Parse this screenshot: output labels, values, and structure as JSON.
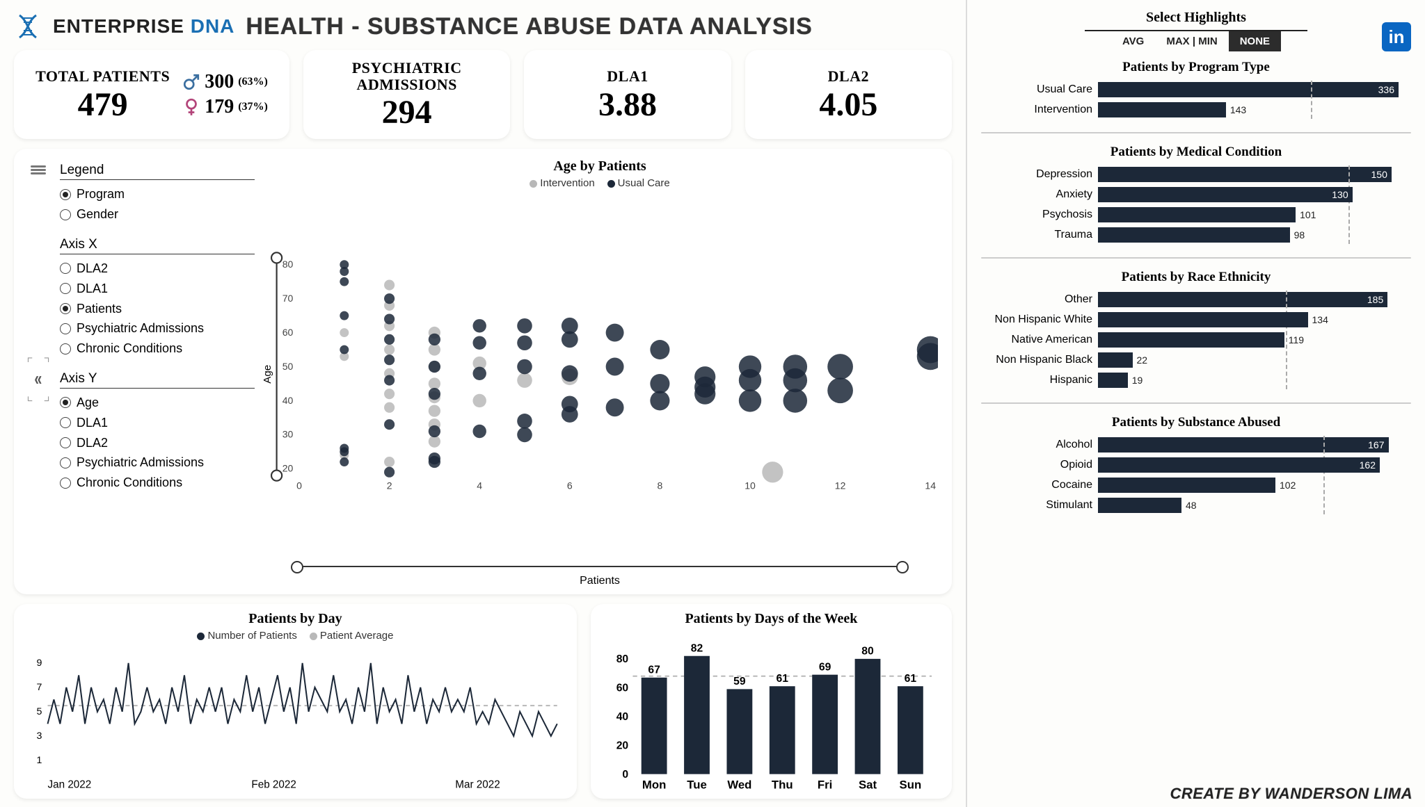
{
  "header": {
    "brand_pre": "ENTERPRISE",
    "brand_post": "DNA",
    "title": "HEALTH - SUBSTANCE ABUSE DATA ANALYSIS"
  },
  "kpis": {
    "total": {
      "label": "TOTAL PATIENTS",
      "value": "479",
      "male": {
        "count": "300",
        "pct": "(63%)"
      },
      "female": {
        "count": "179",
        "pct": "(37%)"
      }
    },
    "psych": {
      "label": "PSYCHIATRIC ADMISSIONS",
      "value": "294"
    },
    "dla1": {
      "label": "DLA1",
      "value": "3.88"
    },
    "dla2": {
      "label": "DLA2",
      "value": "4.05"
    }
  },
  "scatter": {
    "title": "Age by Patients",
    "legend": {
      "intervention": "Intervention",
      "usual": "Usual Care"
    },
    "controls": {
      "legend": {
        "title": "Legend",
        "items": [
          "Program",
          "Gender"
        ],
        "selected": "Program"
      },
      "axisX": {
        "title": "Axis X",
        "items": [
          "DLA2",
          "DLA1",
          "Patients",
          "Psychiatric Admissions",
          "Chronic Conditions"
        ],
        "selected": "Patients"
      },
      "axisY": {
        "title": "Axis Y",
        "items": [
          "Age",
          "DLA1",
          "DLA2",
          "Psychiatric Admissions",
          "Chronic Conditions"
        ],
        "selected": "Age"
      }
    },
    "xlabel": "Patients",
    "ylabel": "Age"
  },
  "patients_by_day": {
    "title": "Patients by Day",
    "legend": {
      "num": "Number of Patients",
      "avg": "Patient Average"
    }
  },
  "patients_by_dow": {
    "title": "Patients by Days of the Week"
  },
  "highlights": {
    "title": "Select Highlights",
    "options": [
      "AVG",
      "MAX | MIN",
      "NONE"
    ],
    "active": "NONE"
  },
  "right_sections": {
    "program": {
      "title": "Patients by Program Type"
    },
    "medical": {
      "title": "Patients by Medical Condition"
    },
    "race": {
      "title": "Patients by Race Ethnicity"
    },
    "substance": {
      "title": "Patients by Substance Abused"
    }
  },
  "credits": "CREATE BY WANDERSON LIMA",
  "chart_data": [
    {
      "id": "age_by_patients_scatter",
      "type": "scatter",
      "title": "Age by Patients",
      "xlabel": "Patients",
      "ylabel": "Age",
      "xlim": [
        0,
        14
      ],
      "ylim": [
        18,
        82
      ],
      "x_ticks": [
        0,
        2,
        4,
        6,
        8,
        10,
        12,
        14
      ],
      "y_ticks": [
        20,
        30,
        40,
        50,
        60,
        70,
        80
      ],
      "series": [
        {
          "name": "Intervention",
          "color": "#b8b8b8",
          "points": [
            {
              "x": 1,
              "y": 24,
              "r": 6
            },
            {
              "x": 1,
              "y": 53,
              "r": 6
            },
            {
              "x": 1,
              "y": 60,
              "r": 6
            },
            {
              "x": 2,
              "y": 22,
              "r": 7
            },
            {
              "x": 2,
              "y": 38,
              "r": 7
            },
            {
              "x": 2,
              "y": 42,
              "r": 7
            },
            {
              "x": 2,
              "y": 48,
              "r": 7
            },
            {
              "x": 2,
              "y": 55,
              "r": 7
            },
            {
              "x": 2,
              "y": 62,
              "r": 7
            },
            {
              "x": 2,
              "y": 68,
              "r": 7
            },
            {
              "x": 2,
              "y": 74,
              "r": 7
            },
            {
              "x": 3,
              "y": 28,
              "r": 8
            },
            {
              "x": 3,
              "y": 33,
              "r": 8
            },
            {
              "x": 3,
              "y": 37,
              "r": 8
            },
            {
              "x": 3,
              "y": 41,
              "r": 8
            },
            {
              "x": 3,
              "y": 45,
              "r": 8
            },
            {
              "x": 3,
              "y": 50,
              "r": 8
            },
            {
              "x": 3,
              "y": 55,
              "r": 8
            },
            {
              "x": 3,
              "y": 60,
              "r": 8
            },
            {
              "x": 4,
              "y": 40,
              "r": 9
            },
            {
              "x": 4,
              "y": 51,
              "r": 9
            },
            {
              "x": 5,
              "y": 46,
              "r": 10
            },
            {
              "x": 6,
              "y": 47,
              "r": 11
            },
            {
              "x": 10.5,
              "y": 19,
              "r": 14
            }
          ]
        },
        {
          "name": "Usual Care",
          "color": "#1c2838",
          "points": [
            {
              "x": 1,
              "y": 22,
              "r": 6
            },
            {
              "x": 1,
              "y": 25,
              "r": 6
            },
            {
              "x": 1,
              "y": 26,
              "r": 6
            },
            {
              "x": 1,
              "y": 55,
              "r": 6
            },
            {
              "x": 1,
              "y": 65,
              "r": 6
            },
            {
              "x": 1,
              "y": 75,
              "r": 6
            },
            {
              "x": 1,
              "y": 78,
              "r": 6
            },
            {
              "x": 1,
              "y": 80,
              "r": 6
            },
            {
              "x": 2,
              "y": 19,
              "r": 7
            },
            {
              "x": 2,
              "y": 33,
              "r": 7
            },
            {
              "x": 2,
              "y": 46,
              "r": 7
            },
            {
              "x": 2,
              "y": 52,
              "r": 7
            },
            {
              "x": 2,
              "y": 58,
              "r": 7
            },
            {
              "x": 2,
              "y": 64,
              "r": 7
            },
            {
              "x": 2,
              "y": 70,
              "r": 7
            },
            {
              "x": 3,
              "y": 22,
              "r": 8
            },
            {
              "x": 3,
              "y": 23,
              "r": 8
            },
            {
              "x": 3,
              "y": 31,
              "r": 8
            },
            {
              "x": 3,
              "y": 42,
              "r": 8
            },
            {
              "x": 3,
              "y": 50,
              "r": 8
            },
            {
              "x": 3,
              "y": 58,
              "r": 8
            },
            {
              "x": 4,
              "y": 31,
              "r": 9
            },
            {
              "x": 4,
              "y": 48,
              "r": 9
            },
            {
              "x": 4,
              "y": 57,
              "r": 9
            },
            {
              "x": 4,
              "y": 62,
              "r": 9
            },
            {
              "x": 5,
              "y": 30,
              "r": 10
            },
            {
              "x": 5,
              "y": 34,
              "r": 10
            },
            {
              "x": 5,
              "y": 50,
              "r": 10
            },
            {
              "x": 5,
              "y": 57,
              "r": 10
            },
            {
              "x": 5,
              "y": 62,
              "r": 10
            },
            {
              "x": 6,
              "y": 36,
              "r": 11
            },
            {
              "x": 6,
              "y": 39,
              "r": 11
            },
            {
              "x": 6,
              "y": 48,
              "r": 11
            },
            {
              "x": 6,
              "y": 58,
              "r": 11
            },
            {
              "x": 6,
              "y": 62,
              "r": 11
            },
            {
              "x": 7,
              "y": 38,
              "r": 12
            },
            {
              "x": 7,
              "y": 50,
              "r": 12
            },
            {
              "x": 7,
              "y": 60,
              "r": 12
            },
            {
              "x": 8,
              "y": 40,
              "r": 13
            },
            {
              "x": 8,
              "y": 45,
              "r": 13
            },
            {
              "x": 8,
              "y": 55,
              "r": 13
            },
            {
              "x": 9,
              "y": 44,
              "r": 14
            },
            {
              "x": 9,
              "y": 47,
              "r": 14
            },
            {
              "x": 9,
              "y": 42,
              "r": 14
            },
            {
              "x": 10,
              "y": 40,
              "r": 15
            },
            {
              "x": 10,
              "y": 46,
              "r": 15
            },
            {
              "x": 10,
              "y": 50,
              "r": 15
            },
            {
              "x": 11,
              "y": 40,
              "r": 16
            },
            {
              "x": 11,
              "y": 46,
              "r": 16
            },
            {
              "x": 11,
              "y": 50,
              "r": 16
            },
            {
              "x": 12,
              "y": 43,
              "r": 17
            },
            {
              "x": 12,
              "y": 50,
              "r": 17
            },
            {
              "x": 14,
              "y": 55,
              "r": 18
            },
            {
              "x": 14,
              "y": 53,
              "r": 18
            }
          ]
        }
      ]
    },
    {
      "id": "patients_by_day",
      "type": "line",
      "title": "Patients by Day",
      "ylabel": "",
      "xlabel": "",
      "ylim": [
        0,
        10
      ],
      "y_ticks": [
        1,
        3,
        5,
        7,
        9
      ],
      "x_categories": [
        "Jan 2022",
        "Feb 2022",
        "Mar 2022"
      ],
      "series": [
        {
          "name": "Number of Patients",
          "color": "#1c2838",
          "values": [
            4,
            6,
            4,
            7,
            5,
            8,
            4,
            7,
            5,
            6,
            4,
            7,
            5,
            9,
            4,
            5,
            7,
            5,
            6,
            4,
            7,
            5,
            8,
            4,
            6,
            5,
            7,
            5,
            7,
            4,
            6,
            5,
            8,
            5,
            7,
            4,
            6,
            8,
            5,
            7,
            4,
            9,
            5,
            7,
            6,
            5,
            8,
            5,
            6,
            4,
            7,
            5,
            9,
            4,
            7,
            5,
            6,
            4,
            8,
            5,
            7,
            4,
            6,
            5,
            7,
            5,
            6,
            5,
            7,
            4,
            5,
            4,
            6,
            5,
            4,
            3,
            5,
            4,
            3,
            5,
            4,
            3,
            4
          ]
        },
        {
          "name": "Patient Average",
          "color": "#b8b8b8",
          "dashed": true,
          "values": [
            5.5
          ]
        }
      ]
    },
    {
      "id": "patients_by_dow",
      "type": "bar",
      "title": "Patients by Days of the Week",
      "categories": [
        "Mon",
        "Tue",
        "Wed",
        "Thu",
        "Fri",
        "Sat",
        "Sun"
      ],
      "values": [
        67,
        82,
        59,
        61,
        69,
        80,
        61
      ],
      "ylim": [
        0,
        90
      ],
      "y_ticks": [
        0,
        20,
        40,
        60,
        80
      ],
      "reference_line": 68
    },
    {
      "id": "patients_by_program",
      "type": "bar",
      "orientation": "horizontal",
      "title": "Patients by Program Type",
      "categories": [
        "Usual Care",
        "Intervention"
      ],
      "values": [
        336,
        143
      ],
      "xlim": [
        0,
        350
      ]
    },
    {
      "id": "patients_by_medical",
      "type": "bar",
      "orientation": "horizontal",
      "title": "Patients by Medical Condition",
      "categories": [
        "Depression",
        "Anxiety",
        "Psychosis",
        "Trauma"
      ],
      "values": [
        150,
        130,
        101,
        98
      ],
      "xlim": [
        0,
        160
      ]
    },
    {
      "id": "patients_by_race",
      "type": "bar",
      "orientation": "horizontal",
      "title": "Patients by Race Ethnicity",
      "categories": [
        "Other",
        "Non Hispanic White",
        "Native American",
        "Non Hispanic Black",
        "Hispanic"
      ],
      "values": [
        185,
        134,
        119,
        22,
        19
      ],
      "xlim": [
        0,
        200
      ]
    },
    {
      "id": "patients_by_substance",
      "type": "bar",
      "orientation": "horizontal",
      "title": "Patients by Substance Abused",
      "categories": [
        "Alcohol",
        "Opioid",
        "Cocaine",
        "Stimulant"
      ],
      "values": [
        167,
        162,
        102,
        48
      ],
      "xlim": [
        0,
        180
      ]
    }
  ]
}
